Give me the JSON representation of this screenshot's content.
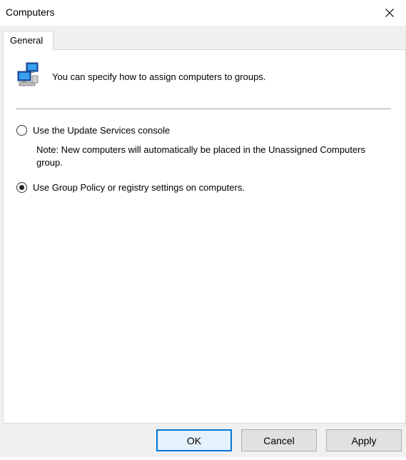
{
  "window": {
    "title": "Computers",
    "close_label": "✕"
  },
  "tabs": [
    {
      "label": "General",
      "selected": true
    }
  ],
  "main": {
    "info_icon": "network-computers-icon",
    "info_text": "You can specify how to assign computers to groups.",
    "options": [
      {
        "label": "Use the Update Services console",
        "selected": false
      },
      {
        "label": "Use Group Policy or registry settings on computers.",
        "selected": true
      }
    ],
    "note": "Note: New computers will automatically be placed in the Unassigned Computers group."
  },
  "buttons": {
    "ok": "OK",
    "cancel": "Cancel",
    "apply": "Apply"
  },
  "colors": {
    "accent": "#0078d7",
    "dialog_bg": "#f0f0f0",
    "panel_bg": "#ffffff"
  }
}
